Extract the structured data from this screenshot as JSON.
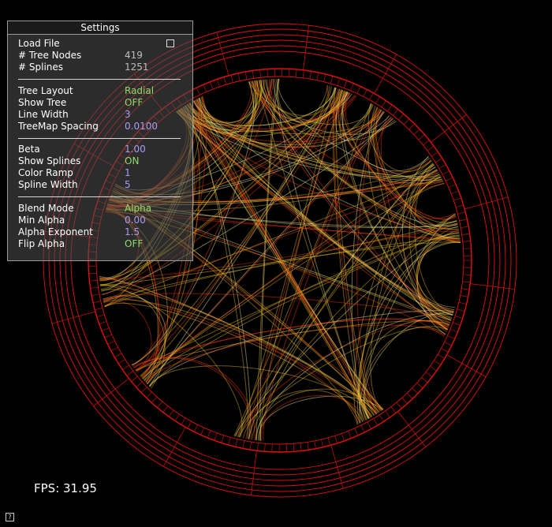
{
  "settings": {
    "title": "Settings",
    "load_file": "Load File",
    "tree_nodes_label": "# Tree Nodes",
    "tree_nodes_value": "419",
    "splines_label": "# Splines",
    "splines_value": "1251",
    "tree_layout_label": "Tree Layout",
    "tree_layout_value": "Radial",
    "show_tree_label": "Show Tree",
    "show_tree_value": "OFF",
    "line_width_label": "Line Width",
    "line_width_value": "3",
    "treemap_spacing_label": "TreeMap Spacing",
    "treemap_spacing_value": "0.0100",
    "beta_label": "Beta",
    "beta_value": "1.00",
    "show_splines_label": "Show Splines",
    "show_splines_value": "ON",
    "color_ramp_label": "Color Ramp",
    "color_ramp_value": "1",
    "spline_width_label": "Spline Width",
    "spline_width_value": "5",
    "blend_mode_label": "Blend Mode",
    "blend_mode_value": "Alpha",
    "min_alpha_label": "Min Alpha",
    "min_alpha_value": "0.00",
    "alpha_exponent_label": "Alpha Exponent",
    "alpha_exponent_value": "1.5",
    "flip_alpha_label": "Flip Alpha",
    "flip_alpha_value": "OFF"
  },
  "fps_text": "FPS: 31.95",
  "help_glyph": "?",
  "colors": {
    "ring": "#e01010",
    "spline_hot": "#ff3a10",
    "spline_mid": "#f0c020",
    "spline_cool": "#f4f0a0"
  }
}
